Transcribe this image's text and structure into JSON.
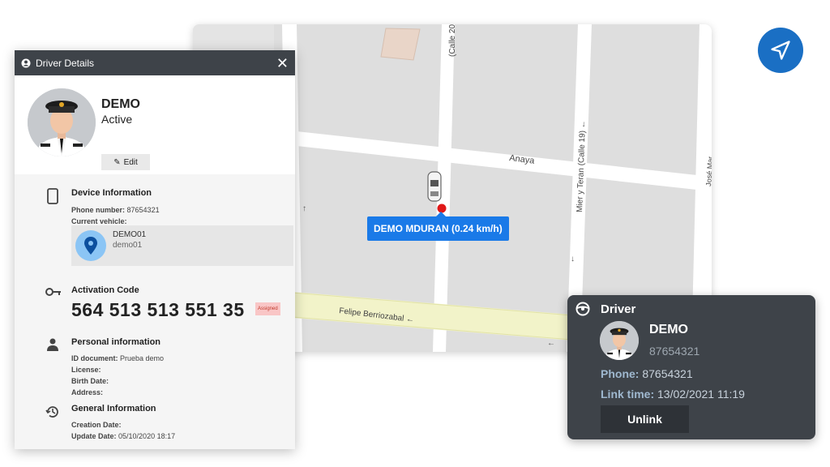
{
  "map": {
    "streets": {
      "calle_20": "(Calle 20",
      "anaya": "Anaya",
      "mier_teran": "Mier y Teran (Calle 19) ←",
      "felipe": "Felipe Berriozabal ←",
      "jose": "José Mar"
    },
    "vehicle_label": "DEMO MDURAN (0.24 km/h)"
  },
  "nav_button": {
    "icon": "navigation-arrow-icon",
    "color": "#1a6fc4"
  },
  "details": {
    "title": "Driver Details",
    "close": "✕",
    "name": "DEMO",
    "status": "Active",
    "edit_label": "Edit",
    "device": {
      "title": "Device Information",
      "phone_label": "Phone number:",
      "phone": "87654321",
      "vehicle_label": "Current vehicle:",
      "vehicle_name": "DEMO01",
      "vehicle_sub": "demo01"
    },
    "activation": {
      "title": "Activation Code",
      "code": "564 513 513 551 35",
      "badge": "Assigned"
    },
    "personal": {
      "title": "Personal information",
      "id_label": "ID document:",
      "id_value": "Prueba demo",
      "license_label": "License:",
      "birth_label": "Birth Date:",
      "address_label": "Address:"
    },
    "general": {
      "title": "General Information",
      "creation_label": "Creation Date:",
      "update_label": "Update Date:",
      "update_value": "05/10/2020 18:17"
    }
  },
  "card": {
    "title": "Driver",
    "name": "DEMO",
    "number": "87654321",
    "phone_label": "Phone:",
    "phone": "87654321",
    "link_label": "Link time:",
    "link_time": "13/02/2021 11:19",
    "unlink_label": "Unlink"
  },
  "colors": {
    "header": "#3e4349",
    "accent": "#1a7ae8",
    "badge": "#f9c6c6"
  }
}
